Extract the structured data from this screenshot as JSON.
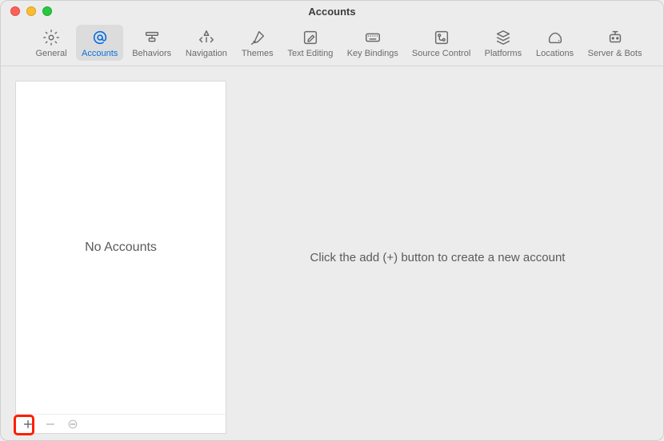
{
  "window": {
    "title": "Accounts"
  },
  "toolbar": {
    "items": [
      {
        "id": "general",
        "label": "General"
      },
      {
        "id": "accounts",
        "label": "Accounts"
      },
      {
        "id": "behaviors",
        "label": "Behaviors"
      },
      {
        "id": "navigation",
        "label": "Navigation"
      },
      {
        "id": "themes",
        "label": "Themes"
      },
      {
        "id": "text-editing",
        "label": "Text Editing"
      },
      {
        "id": "key-bindings",
        "label": "Key Bindings"
      },
      {
        "id": "source-control",
        "label": "Source Control"
      },
      {
        "id": "platforms",
        "label": "Platforms"
      },
      {
        "id": "locations",
        "label": "Locations"
      },
      {
        "id": "server-bots",
        "label": "Server & Bots"
      }
    ],
    "selected": "accounts"
  },
  "sidebar": {
    "empty_label": "No Accounts",
    "footer": {
      "add": "+",
      "remove": "−",
      "more": "⋯"
    }
  },
  "detail": {
    "empty_prompt": "Click the add (+) button to create a new account"
  }
}
